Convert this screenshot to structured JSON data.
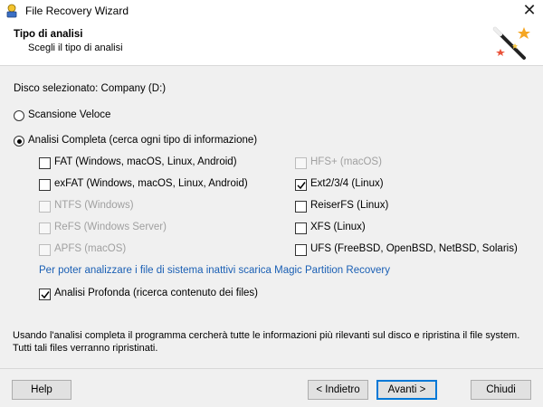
{
  "window": {
    "title": "File Recovery Wizard",
    "close_glyph": "✕"
  },
  "header": {
    "title": "Tipo di analisi",
    "subtitle": "Scegli il tipo di analisi"
  },
  "disk_label": "Disco selezionato: Company (D:)",
  "scan_options": {
    "fast": {
      "label": "Scansione Veloce",
      "selected": false
    },
    "full": {
      "label": "Analisi Completa (cerca ogni tipo di informazione)",
      "selected": true
    }
  },
  "filesystems_left": [
    {
      "label": "FAT (Windows, macOS, Linux, Android)",
      "checked": false,
      "enabled": true
    },
    {
      "label": "exFAT (Windows, macOS, Linux, Android)",
      "checked": false,
      "enabled": true
    },
    {
      "label": "NTFS (Windows)",
      "checked": false,
      "enabled": false
    },
    {
      "label": "ReFS (Windows Server)",
      "checked": false,
      "enabled": false
    },
    {
      "label": "APFS (macOS)",
      "checked": false,
      "enabled": false
    }
  ],
  "filesystems_right": [
    {
      "label": "HFS+ (macOS)",
      "checked": false,
      "enabled": false
    },
    {
      "label": "Ext2/3/4 (Linux)",
      "checked": true,
      "enabled": true
    },
    {
      "label": "ReiserFS (Linux)",
      "checked": false,
      "enabled": true
    },
    {
      "label": "XFS (Linux)",
      "checked": false,
      "enabled": true
    },
    {
      "label": "UFS (FreeBSD, OpenBSD, NetBSD, Solaris)",
      "checked": false,
      "enabled": true
    }
  ],
  "partition_link": "Per poter analizzare i file di sistema inattivi scarica Magic Partition Recovery",
  "deep_scan": {
    "label": "Analisi Profonda (ricerca contenuto dei files)",
    "checked": true
  },
  "bottom_note": "Usando l'analisi completa il programma cercherà tutte le informazioni più rilevanti sul disco e ripristina il file system. Tutti tali files verranno ripristinati.",
  "buttons": {
    "help": "Help",
    "back": "< Indietro",
    "next": "Avanti >",
    "close": "Chiudi"
  },
  "colors": {
    "link": "#1a5fb4",
    "default_button_border": "#0078d7"
  }
}
